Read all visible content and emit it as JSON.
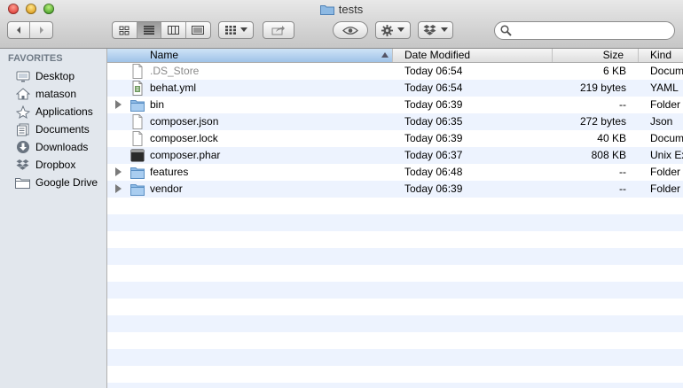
{
  "window": {
    "title": "tests"
  },
  "toolbar": {
    "back_icon": "chevron-left-icon",
    "forward_icon": "chevron-right-icon",
    "view_modes": [
      "icon-view-icon",
      "list-view-icon",
      "column-view-icon",
      "coverflow-view-icon"
    ],
    "active_view": "list",
    "arrange_icon": "arrange-grid-icon",
    "share_icon": "share-icon",
    "quicklook_icon": "eye-icon",
    "action_icon": "gear-icon",
    "dropbox_icon": "dropbox-icon",
    "search_placeholder": ""
  },
  "sidebar": {
    "heading": "FAVORITES",
    "items": [
      {
        "label": "Desktop",
        "icon": "desktop-icon"
      },
      {
        "label": "matason",
        "icon": "home-icon"
      },
      {
        "label": "Applications",
        "icon": "applications-icon"
      },
      {
        "label": "Documents",
        "icon": "documents-icon"
      },
      {
        "label": "Downloads",
        "icon": "downloads-icon"
      },
      {
        "label": "Dropbox",
        "icon": "dropbox-icon"
      },
      {
        "label": "Google Drive",
        "icon": "folder-icon"
      }
    ]
  },
  "columns": {
    "name": "Name",
    "date_modified": "Date Modified",
    "size": "Size",
    "kind": "Kind",
    "sorted_by": "Name"
  },
  "files": [
    {
      "name": ".DS_Store",
      "date": "Today 06:54",
      "size": "6 KB",
      "kind": "Document",
      "type": "document",
      "hidden": true,
      "expandable": false
    },
    {
      "name": "behat.yml",
      "date": "Today 06:54",
      "size": "219 bytes",
      "kind": "YAML",
      "type": "yaml",
      "hidden": false,
      "expandable": false
    },
    {
      "name": "bin",
      "date": "Today 06:39",
      "size": "--",
      "kind": "Folder",
      "type": "folder",
      "hidden": false,
      "expandable": true
    },
    {
      "name": "composer.json",
      "date": "Today 06:35",
      "size": "272 bytes",
      "kind": "Json",
      "type": "document",
      "hidden": false,
      "expandable": false
    },
    {
      "name": "composer.lock",
      "date": "Today 06:39",
      "size": "40 KB",
      "kind": "Document",
      "type": "document",
      "hidden": false,
      "expandable": false
    },
    {
      "name": "composer.phar",
      "date": "Today 06:37",
      "size": "808 KB",
      "kind": "Unix Executable",
      "type": "executable",
      "hidden": false,
      "expandable": false
    },
    {
      "name": "features",
      "date": "Today 06:48",
      "size": "--",
      "kind": "Folder",
      "type": "folder",
      "hidden": false,
      "expandable": true
    },
    {
      "name": "vendor",
      "date": "Today 06:39",
      "size": "--",
      "kind": "Folder",
      "type": "folder",
      "hidden": false,
      "expandable": true
    }
  ],
  "colors": {
    "sidebar_bg": "#e2e7ed",
    "row_stripe": "#edf3fe",
    "folder_blue": "#7fb2e0",
    "sort_header": "#9fc3e8"
  }
}
